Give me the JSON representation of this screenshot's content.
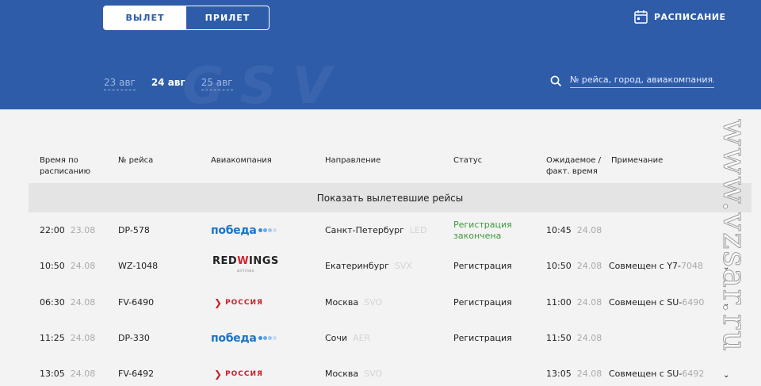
{
  "header": {
    "tabs": [
      {
        "label": "ВЫЛЕТ",
        "active": true
      },
      {
        "label": "ПРИЛЕТ",
        "active": false
      }
    ],
    "schedule_label": "РАСПИСАНИЕ",
    "dates": [
      {
        "label": "23 авг",
        "current": false
      },
      {
        "label": "24 авг",
        "current": true
      },
      {
        "label": "25 авг",
        "current": false
      }
    ],
    "search_placeholder": "№ рейса, город, авиакомпания..."
  },
  "columns": {
    "sched_time_line1": "Время по",
    "sched_time_line2": "расписанию",
    "flight": "№ рейса",
    "airline": "Авиакомпания",
    "direction": "Направление",
    "status": "Статус",
    "actual_line1": "Ожидаемое /",
    "actual_line2": "факт. время",
    "note": "Примечание"
  },
  "show_departed": "Показать вылетевшие рейсы",
  "logos": {
    "pobeda": "победа",
    "redwings_a": "RED",
    "redwings_b": "W",
    "redwings_c": "INGS",
    "redwings_sub": "airlines",
    "rossiya": "РОССИЯ"
  },
  "flights": [
    {
      "time": "22:00",
      "date": "23.08",
      "flight": "DP-578",
      "airline": "pobeda",
      "city": "Санкт-Петербург",
      "code": "LED",
      "status_l1": "Регистрация",
      "status_l2": "закончена",
      "status_color": "#3a9a3a",
      "act_time": "10:45",
      "act_date": "24.08",
      "note": "",
      "note_code": ""
    },
    {
      "time": "10:50",
      "date": "24.08",
      "flight": "WZ-1048",
      "airline": "redwings",
      "city": "Екатеринбург",
      "code": "SVX",
      "status_l1": "Регистрация",
      "status_l2": "",
      "status_color": "#222222",
      "act_time": "10:50",
      "act_date": "24.08",
      "note": "Совмещен с Y7-",
      "note_code": "7048"
    },
    {
      "time": "06:30",
      "date": "24.08",
      "flight": "FV-6490",
      "airline": "rossiya",
      "city": "Москва",
      "code": "SVO",
      "status_l1": "Регистрация",
      "status_l2": "",
      "status_color": "#222222",
      "act_time": "11:00",
      "act_date": "24.08",
      "note": "Совмещен с SU-",
      "note_code": "6490"
    },
    {
      "time": "11:25",
      "date": "24.08",
      "flight": "DP-330",
      "airline": "pobeda",
      "city": "Сочи",
      "code": "AER",
      "status_l1": "Регистрация",
      "status_l2": "",
      "status_color": "#222222",
      "act_time": "11:50",
      "act_date": "24.08",
      "note": "",
      "note_code": ""
    },
    {
      "time": "13:05",
      "date": "24.08",
      "flight": "FV-6492",
      "airline": "rossiya",
      "city": "Москва",
      "code": "SVO",
      "status_l1": "",
      "status_l2": "",
      "status_color": "#222222",
      "act_time": "13:05",
      "act_date": "24.08",
      "note": "Совмещен с SU-",
      "note_code": "6492"
    }
  ],
  "watermark": "www.vzsar.ru",
  "colors": {
    "header_bg": "#2e5ca9",
    "accent_green": "#3a9a3a",
    "brand_pobeda": "#1a73c9",
    "brand_red": "#d3232f"
  }
}
